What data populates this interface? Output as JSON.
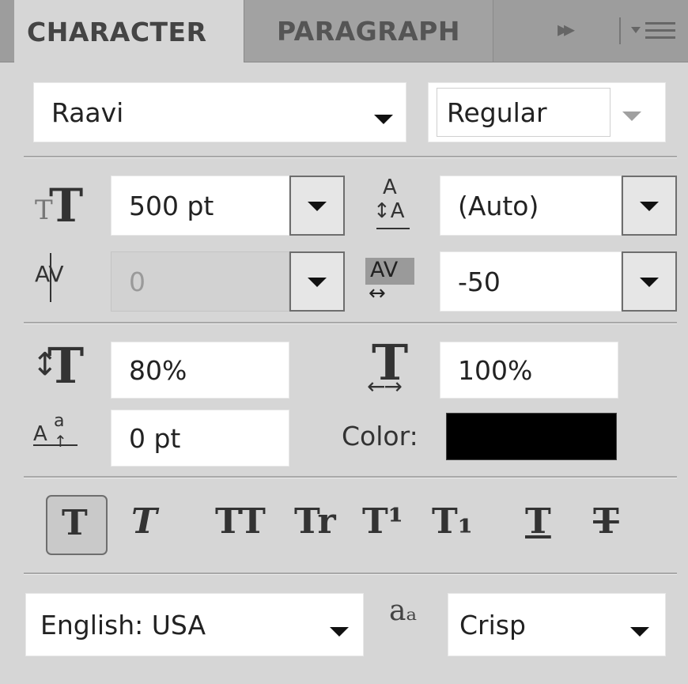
{
  "tabs": {
    "character": "CHARACTER",
    "paragraph": "PARAGRAPH",
    "more": "▸▸"
  },
  "font": {
    "family": "Raavi",
    "style": "Regular"
  },
  "metrics": {
    "size": "500 pt",
    "leading": "(Auto)",
    "kerning": "0",
    "tracking": "-50",
    "vertical_scale": "80%",
    "horizontal_scale": "100%",
    "baseline_shift": "0 pt",
    "color_label": "Color:",
    "color_value": "#000000"
  },
  "style_buttons": [
    "T",
    "T",
    "TT",
    "Tr",
    "T¹",
    "T₁",
    "T",
    "T"
  ],
  "language": "English: USA",
  "antialias_icon": "aₐ",
  "antialias": "Crisp",
  "icons": [
    "font-size-icon",
    "leading-icon",
    "kerning-icon",
    "tracking-icon",
    "vertical-scale-icon",
    "horizontal-scale-icon",
    "baseline-shift-icon",
    "antialias-icon",
    "panel-menu-icon",
    "fast-forward-icon"
  ]
}
